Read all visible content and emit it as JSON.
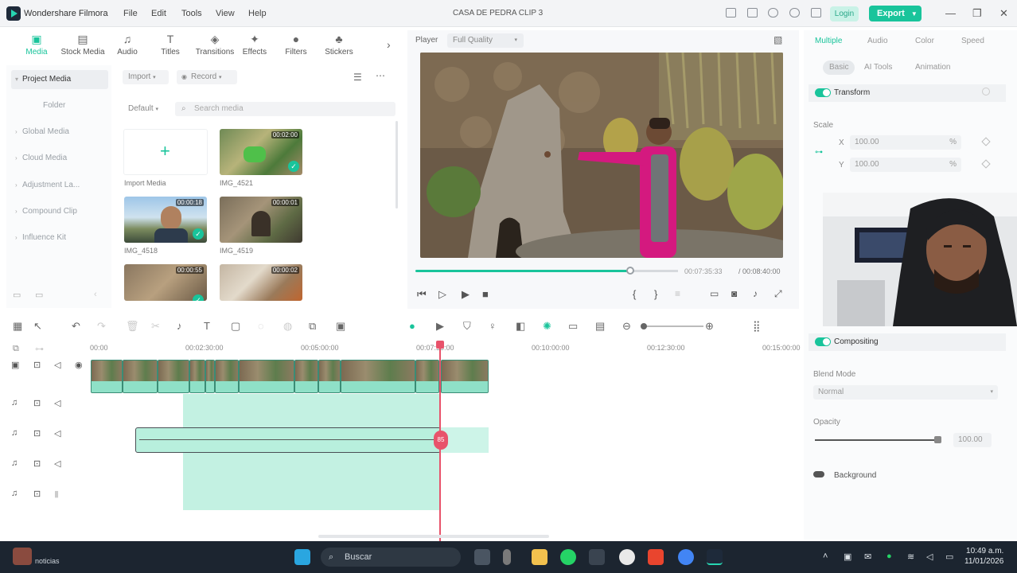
{
  "app": {
    "name": "Wondershare Filmora",
    "project_title": "CASA DE PEDRA CLIP 3",
    "menu": [
      "File",
      "Edit",
      "Tools",
      "View",
      "Help"
    ],
    "login_label": "Login",
    "export_label": "Export"
  },
  "media_tabs": [
    {
      "label": "Media",
      "icon": "media-icon",
      "active": true
    },
    {
      "label": "Stock Media",
      "icon": "stock-media-icon"
    },
    {
      "label": "Audio",
      "icon": "music-icon"
    },
    {
      "label": "Titles",
      "icon": "text-icon"
    },
    {
      "label": "Transitions",
      "icon": "transitions-icon"
    },
    {
      "label": "Effects",
      "icon": "effects-icon"
    },
    {
      "label": "Filters",
      "icon": "filters-icon"
    },
    {
      "label": "Stickers",
      "icon": "stickers-icon"
    }
  ],
  "sidebar": {
    "items": [
      "Project Media",
      "Folder",
      "Global Media",
      "Cloud Media",
      "Adjustment La...",
      "Compound Clip",
      "Influence Kit"
    ]
  },
  "media_toolbar": {
    "import_label": "Import",
    "record_label": "Record",
    "sort_label": "Default",
    "search_placeholder": "Search media"
  },
  "media_items": [
    {
      "label": "Import Media"
    },
    {
      "label": "IMG_4521",
      "duration": "00:02:00",
      "used": true
    },
    {
      "label": "IMG_4518",
      "duration": "00:00:18",
      "used": true
    },
    {
      "label": "IMG_4519",
      "duration": "00:00:01",
      "used": false
    },
    {
      "label": "",
      "duration": "00:00:55",
      "used": true
    },
    {
      "label": "",
      "duration": "00:00:02",
      "used": false
    }
  ],
  "player": {
    "label": "Player",
    "quality": "Full Quality",
    "current_time": "00:07:35:33",
    "total_time": "/ 00:08:40:00",
    "progress": 0.76
  },
  "inspector": {
    "tabs": [
      "Multiple",
      "Audio",
      "Color",
      "Speed"
    ],
    "subtabs": [
      "Basic",
      "AI Tools",
      "Animation"
    ],
    "transform_label": "Transform",
    "scale_label": "Scale",
    "scale_x": "100.00",
    "scale_y": "100.00",
    "percent": "%",
    "x_label": "X",
    "y_label": "Y",
    "compositing_label": "Compositing",
    "blend_mode_label": "Blend Mode",
    "blend_mode_value": "Normal",
    "opacity_label": "Opacity",
    "opacity_value": "100.00",
    "background_label": "Background"
  },
  "timeline": {
    "ruler": [
      "00:00",
      "00:02:30:00",
      "00:05:00:00",
      "00:07:30:00",
      "00:10:00:00",
      "00:12:30:00",
      "00:15:00:00"
    ],
    "playhead_marker": "85"
  },
  "taskbar": {
    "search_label": "Buscar",
    "weather": "noticias",
    "clock_time": "10:49 a.m.",
    "clock_date": "11/01/2026"
  }
}
